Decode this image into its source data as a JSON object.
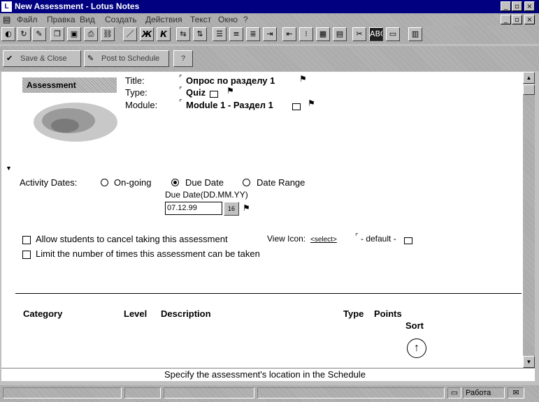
{
  "window": {
    "title": "New Assessment - Lotus Notes",
    "app_icon": "lotus-notes-icon"
  },
  "menubar": {
    "items": [
      "Файл",
      "Правка",
      "Вид",
      "Создать",
      "Действия",
      "Текст",
      "Окно",
      "?"
    ]
  },
  "actionbar": {
    "save_close": "Save & Close",
    "post_schedule": "Post to Schedule"
  },
  "form": {
    "logo_text": "Assessment",
    "title_label": "Title:",
    "title_value": "Опрос по разделу 1",
    "type_label": "Type:",
    "type_value": "Quiz",
    "module_label": "Module:",
    "module_value": "Module 1 - Раздел 1",
    "activity_dates_label": "Activity Dates:",
    "option_ongoing": "On-going",
    "option_due_date": "Due Date",
    "option_date_range": "Date Range",
    "selected_option": "Due Date",
    "due_date_label": "Due Date(DD.MM.YY)",
    "due_date_value": "07.12.99",
    "calendar_button": "16",
    "allow_cancel_label": "Allow students to cancel taking this assessment",
    "limit_times_label": "Limit the number of times this assessment can be taken",
    "view_icon_label": "View Icon:",
    "view_icon_select": "<select>",
    "view_icon_value": "- default -"
  },
  "table": {
    "headers": {
      "category": "Category",
      "level": "Level",
      "description": "Description",
      "type": "Type",
      "points": "Points",
      "sort": "Sort"
    }
  },
  "hint": "Specify the assessment's location in the Schedule",
  "statusbar": {
    "location": "Работа"
  }
}
